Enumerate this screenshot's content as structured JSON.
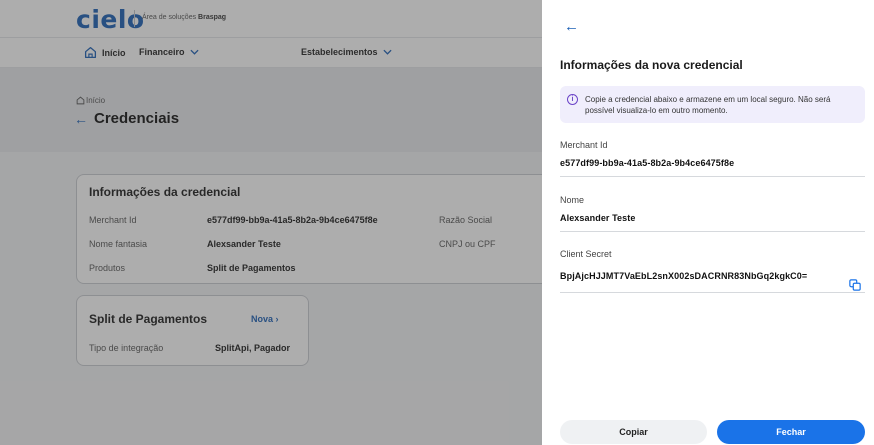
{
  "header": {
    "logo": "cielo",
    "subtitle_prefix": "Área de soluções",
    "subtitle_brand": "Braspag"
  },
  "nav": {
    "inicio": "Início",
    "financeiro": "Financeiro",
    "estabelecimentos": "Estabelecimentos"
  },
  "breadcrumb": "Início",
  "page_title": "Credenciais",
  "card_info": {
    "title": "Informações da credencial",
    "merchant_id_label": "Merchant Id",
    "merchant_id_value": "e577df99-bb9a-41a5-8b2a-9b4ce6475f8e",
    "razao_social_label": "Razão Social",
    "nome_fantasia_label": "Nome fantasia",
    "nome_fantasia_value": "Alexsander Teste",
    "cnpj_label": "CNPJ ou CPF",
    "produtos_label": "Produtos",
    "produtos_value": "Split de Pagamentos"
  },
  "card_split": {
    "title": "Split de Pagamentos",
    "nova_label": "Nova",
    "tipo_label": "Tipo de integração",
    "tipo_value": "SplitApi,  Pagador"
  },
  "drawer": {
    "title": "Informações da nova credencial",
    "alert_text": "Copie a credencial abaixo e armazene em um local seguro. Não será possível visualiza-lo em outro momento.",
    "merchant_id_label": "Merchant Id",
    "merchant_id_value": "e577df99-bb9a-41a5-8b2a-9b4ce6475f8e",
    "nome_label": "Nome",
    "nome_value": "Alexsander Teste",
    "client_secret_label": "Client Secret",
    "client_secret_value": "BpjAjcHJJMT7VaEbL2snX002sDACRNR83NbGq2kgkC0=",
    "copiar_label": "Copiar",
    "fechar_label": "Fechar"
  },
  "colors": {
    "brand_blue": "#1b5fb5",
    "primary_button": "#1a73e8",
    "alert_bg": "#f0eefc",
    "alert_icon": "#6b44c8"
  }
}
